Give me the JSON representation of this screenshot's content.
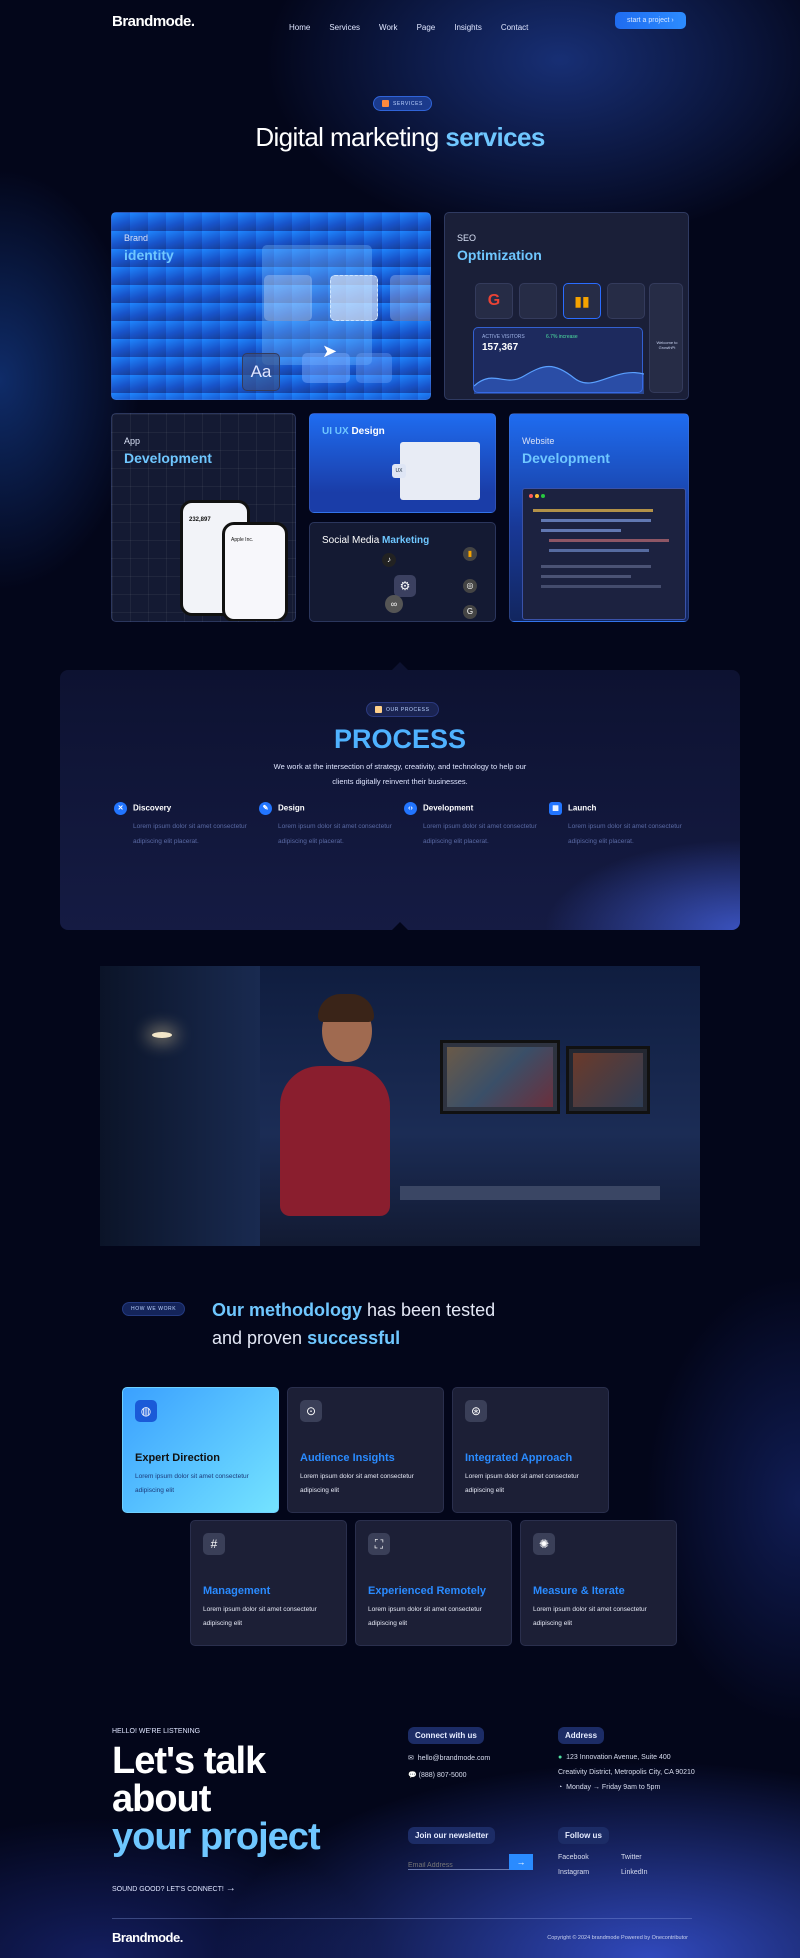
{
  "nav": {
    "logo": "Brandmode.",
    "links": [
      "Home",
      "Services",
      "Work",
      "Page",
      "Insights",
      "Contact"
    ],
    "cta": "start a project"
  },
  "hero": {
    "badge": "SERVICES",
    "title_plain": "Digital marketing",
    "title_accent": "services"
  },
  "services": {
    "brand": {
      "t1": "Brand",
      "t2": "identity",
      "font_sample": "Aa"
    },
    "seo": {
      "t1": "SEO",
      "t2": "Optimization",
      "widget_label": "ACTIVE VISITORS",
      "widget_value": "157,367",
      "widget_change": "6.7% increase",
      "side_label": "Welcome to GrowthPt"
    },
    "app": {
      "t1": "App",
      "t2": "Development",
      "phone_value": "232,897",
      "phone_title": "Apple Inc."
    },
    "uiux": {
      "t1": "UI UX",
      "t2": "Design",
      "badge": "UX"
    },
    "social": {
      "t1": "Social Media",
      "t2": "Marketing"
    },
    "web": {
      "t1": "Website",
      "t2": "Development"
    }
  },
  "process": {
    "badge": "OUR PROCESS",
    "title": "PROCESS",
    "desc1": "We work at the intersection of strategy, creativity, and technology to help our",
    "desc2": "clients digitally reinvent their businesses.",
    "steps": [
      {
        "title": "Discovery",
        "d1": "Lorem ipsum dolor sit amet consectetur",
        "d2": "adipiscing elit placerat."
      },
      {
        "title": "Design",
        "d1": "Lorem ipsum dolor sit amet consectetur",
        "d2": "adipiscing elit placerat."
      },
      {
        "title": "Development",
        "d1": "Lorem ipsum dolor sit amet consectetur",
        "d2": "adipiscing elit placerat."
      },
      {
        "title": "Launch",
        "d1": "Lorem ipsum dolor sit amet consectetur",
        "d2": "adipiscing elit placerat."
      }
    ]
  },
  "method": {
    "badge": "HOW WE WORK",
    "l1a": "Our methodology",
    "l1b": " has been tested",
    "l2a": "and proven ",
    "l2b": "successful",
    "cards": [
      {
        "title": "Expert Direction",
        "d1": "Lorem ipsum dolor sit amet consectetur",
        "d2": "adipiscing elit",
        "icon": "grid-circle-icon"
      },
      {
        "title": "Audience Insights",
        "d1": "Lorem ipsum dolor sit amet consectetur",
        "d2": "adipiscing elit",
        "icon": "target-icon"
      },
      {
        "title": "Integrated Approach",
        "d1": "Lorem ipsum dolor sit amet consectetur",
        "d2": "adipiscing elit",
        "icon": "circles-icon"
      },
      {
        "title": "Management",
        "d1": "Lorem ipsum dolor sit amet consectetur",
        "d2": "adipiscing elit",
        "icon": "hash-icon"
      },
      {
        "title": "Experienced Remotely",
        "d1": "Lorem ipsum dolor sit amet consectetur",
        "d2": "adipiscing elit",
        "icon": "frame-icon"
      },
      {
        "title": "Measure & Iterate",
        "d1": "Lorem ipsum dolor sit amet consectetur",
        "d2": "adipiscing elit",
        "icon": "aperture-icon"
      }
    ]
  },
  "contact": {
    "eyebrow": "HELLO! WE'RE LISTENING",
    "h1": "Let's talk",
    "h2": "about",
    "h3": "your project",
    "sub": "SOUND GOOD? LET'S CONNECT!",
    "connect_label": "Connect with us",
    "email": "hello@brandmode.com",
    "phone": "(888) 807-5000",
    "address_label": "Address",
    "addr1": "123 Innovation Avenue, Suite 400",
    "addr2": "Creativity District, Metropolis City, CA 90210",
    "hours": "Monday → Friday 9am to 5pm",
    "newsletter_label": "Join our newsletter",
    "email_placeholder": "Email Address",
    "follow_label": "Follow us",
    "socials": [
      "Facebook",
      "Twitter",
      "Instagram",
      "LinkedIn"
    ]
  },
  "footer": {
    "logo": "Brandmode.",
    "copyright": "Copyright © 2024 brandmode Powered by Onecontributor"
  }
}
